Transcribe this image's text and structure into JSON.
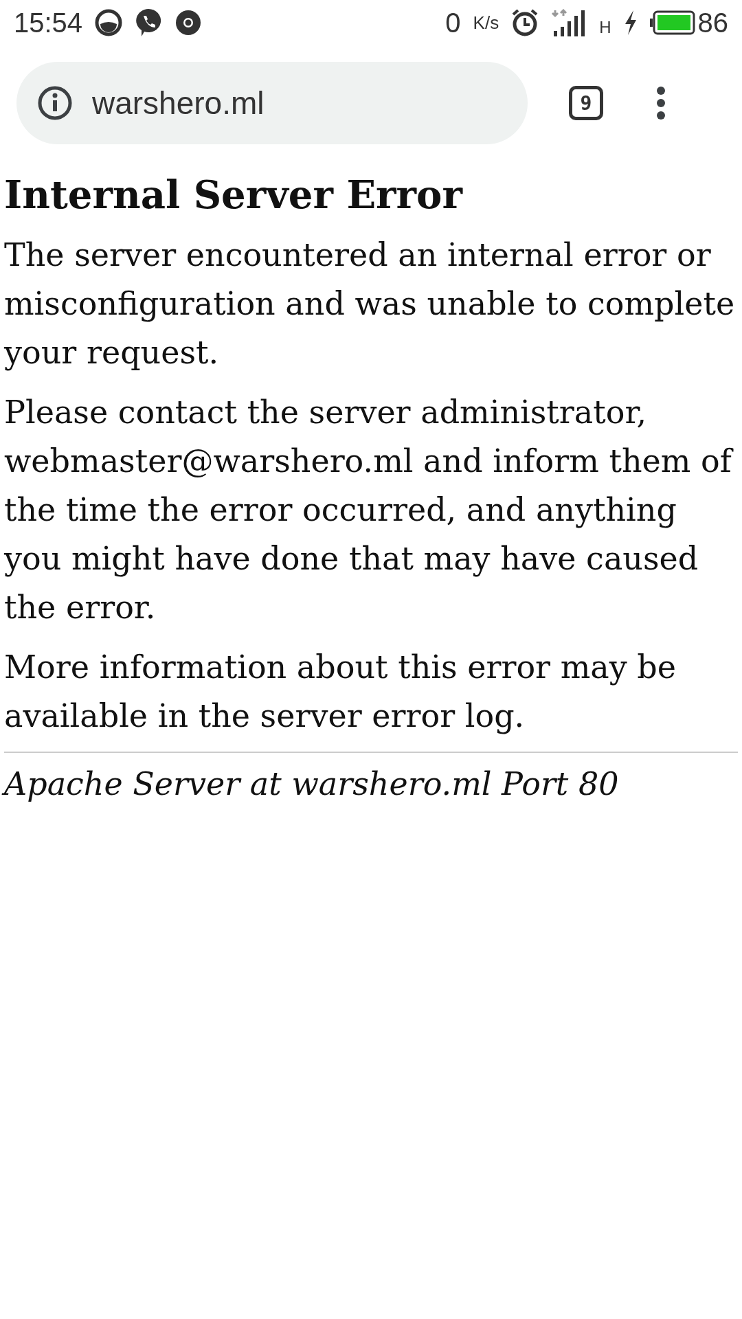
{
  "status_bar": {
    "time": "15:54",
    "speed_value": "0",
    "speed_unit": "K/s",
    "network_type": "H",
    "battery": "86"
  },
  "browser": {
    "url": "warshero.ml",
    "tab_count": "9"
  },
  "page": {
    "heading": "Internal Server Error",
    "paragraphs": [
      "The server encountered an internal error or misconfiguration and was unable to complete your request.",
      "Please contact the server administrator, webmaster@warshero.ml and inform them of the time the error occurred, and anything you might have done that may have caused the error.",
      "More information about this error may be available in the server error log."
    ],
    "footer": "Apache Server at warshero.ml Port 80"
  }
}
